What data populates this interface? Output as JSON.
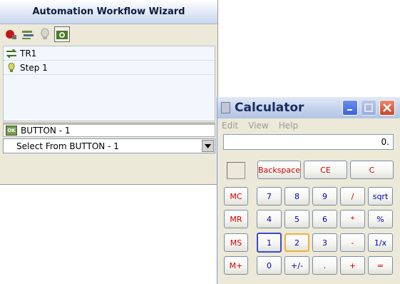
{
  "wizard": {
    "title": "Automation Workflow Wizard",
    "toolbar": [
      "record-icon",
      "steps-icon",
      "bulb-icon",
      "camera-icon"
    ],
    "tree": [
      {
        "label": "TR1",
        "icon": "arrows-icon"
      },
      {
        "label": "Step 1",
        "icon": "bulb-icon"
      }
    ],
    "button_item": {
      "icon_text": "OK",
      "label": "BUTTON - 1"
    },
    "select": {
      "value": "Select From BUTTON - 1"
    }
  },
  "calculator": {
    "title": "Calculator",
    "menu": [
      "Edit",
      "View",
      "Help"
    ],
    "display": "0.",
    "buttons": {
      "backspace": "Backspace",
      "ce": "CE",
      "c": "C",
      "mc": "MC",
      "mr": "MR",
      "ms": "MS",
      "mplus": "M+",
      "k7": "7",
      "k8": "8",
      "k9": "9",
      "div": "/",
      "sqrt": "sqrt",
      "k4": "4",
      "k5": "5",
      "k6": "6",
      "mul": "*",
      "pct": "%",
      "k1": "1",
      "k2": "2",
      "k3": "3",
      "sub": "-",
      "inv": "1/x",
      "k0": "0",
      "sign": "+/-",
      "dot": ".",
      "add": "+",
      "eq": "="
    },
    "colors": {
      "red": "#d00000",
      "blue": "#0000b0"
    }
  }
}
